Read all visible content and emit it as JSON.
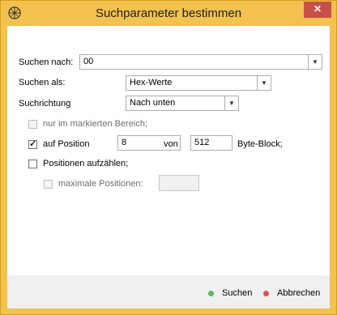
{
  "window": {
    "title": "Suchparameter bestimmen",
    "close_glyph": "✕"
  },
  "form": {
    "search_for_label": "Suchen nach:",
    "search_for_value": "00",
    "search_as_label": "Suchen als:",
    "search_as_value": "Hex-Werte",
    "direction_label": "Suchrichtung",
    "direction_value": "Nach unten"
  },
  "options": {
    "marked_area_label": "nur im markierten Bereich;",
    "at_position_label": "auf Position",
    "position_value": "8",
    "of_label": "von",
    "block_value": "512",
    "byte_block_label": "Byte-Block;",
    "enumerate_label": "Positionen aufzählen;",
    "max_positions_label": "maximale Positionen:",
    "max_positions_value": ""
  },
  "footer": {
    "search_label": "Suchen",
    "cancel_label": "Abbrechen",
    "search_dot_color": "#5cb85c",
    "cancel_dot_color": "#d9534f"
  }
}
